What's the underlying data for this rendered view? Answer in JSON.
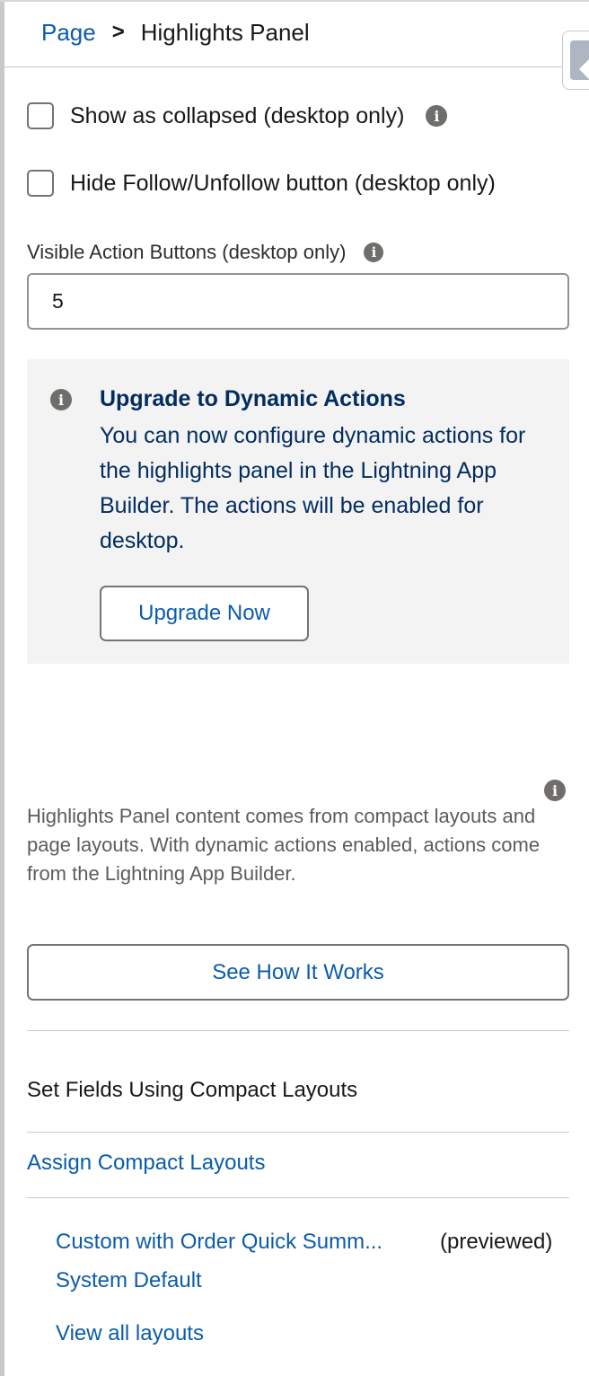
{
  "breadcrumb": {
    "parent": "Page",
    "separator": ">",
    "current": "Highlights Panel"
  },
  "panel_collapse": {
    "icon": "chevron-left-icon"
  },
  "options": {
    "show_collapsed": {
      "label": "Show as collapsed (desktop only)",
      "checked": false,
      "info_icon": "i"
    },
    "hide_follow": {
      "label": "Hide Follow/Unfollow button (desktop only)",
      "checked": false
    }
  },
  "visible_actions": {
    "label": "Visible Action Buttons (desktop only)",
    "info_icon": "i",
    "value": "5"
  },
  "upgrade_notice": {
    "icon": "i",
    "title": "Upgrade to Dynamic Actions",
    "body": "You can now configure dynamic actions for the highlights panel in the Lightning App Builder. The actions will be enabled for desktop.",
    "button": "Upgrade Now"
  },
  "help": {
    "icon": "i",
    "text": "Highlights Panel content comes from compact layouts and page layouts. With dynamic actions enabled, actions come from the Lightning App Builder.",
    "button": "See How It Works"
  },
  "compact_layouts": {
    "heading": "Set Fields Using Compact Layouts",
    "assign_link": "Assign Compact Layouts",
    "layouts": [
      {
        "name": "Custom with Order Quick Summ...",
        "status": "(previewed)"
      },
      {
        "name": "System Default",
        "status": ""
      }
    ],
    "view_all": "View all layouts"
  },
  "colors": {
    "link": "#0b5cab",
    "notice_bg": "#f3f3f3",
    "notice_text": "#032d60",
    "info_icon": "#706e6b"
  }
}
